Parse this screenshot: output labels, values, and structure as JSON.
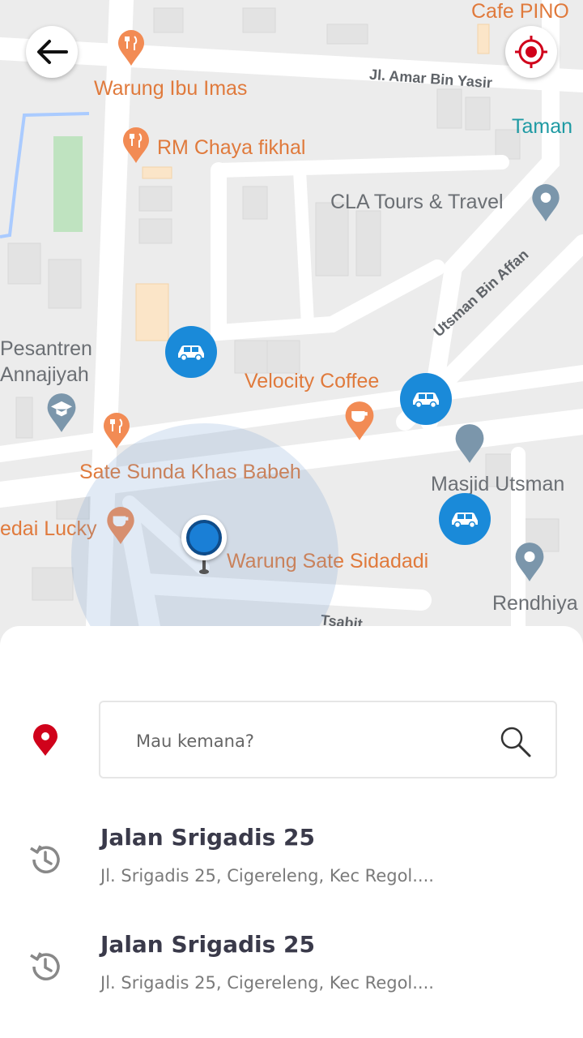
{
  "map": {
    "places": {
      "cafe_pino": "Cafe PINO",
      "warung_ibu_imas": "Warung Ibu Imas",
      "jl_amar": "Jl. Amar Bin Yasir",
      "taman": "Taman",
      "rm_chaya": "RM Chaya fikhal",
      "cla_tours": "CLA Tours & Travel",
      "pesantren_1": "Pesantren",
      "pesantren_2": "Annajiyah",
      "velocity": "Velocity Coffee",
      "utsman_street": "Utsman Bin Affan",
      "sate_sunda": "Sate Sunda Khas Babeh",
      "masjid": "Masjid Utsman",
      "kedai_lucky": "edai Lucky",
      "warung_sate": "Warung Sate Sidadadi",
      "rendhiya": "Rendhiya",
      "tsabit": "Tsabit"
    },
    "icons": {
      "back": "arrow-left-icon",
      "locate": "crosshair-target-icon",
      "car": "car-icon",
      "my_location": "current-location-dot"
    },
    "colors": {
      "car": "#1a8ad9",
      "poi_orange": "#e07a3c",
      "accent_red": "#d0021b"
    }
  },
  "search": {
    "placeholder": "Mau kemana?",
    "icon": "search-icon"
  },
  "history": [
    {
      "title": "Jalan Srigadis 25",
      "subtitle": "Jl. Srigadis 25, Cigereleng, Kec Regol....",
      "icon": "history-icon"
    },
    {
      "title": "Jalan Srigadis 25",
      "subtitle": "Jl. Srigadis 25, Cigereleng, Kec Regol....",
      "icon": "history-icon"
    }
  ]
}
